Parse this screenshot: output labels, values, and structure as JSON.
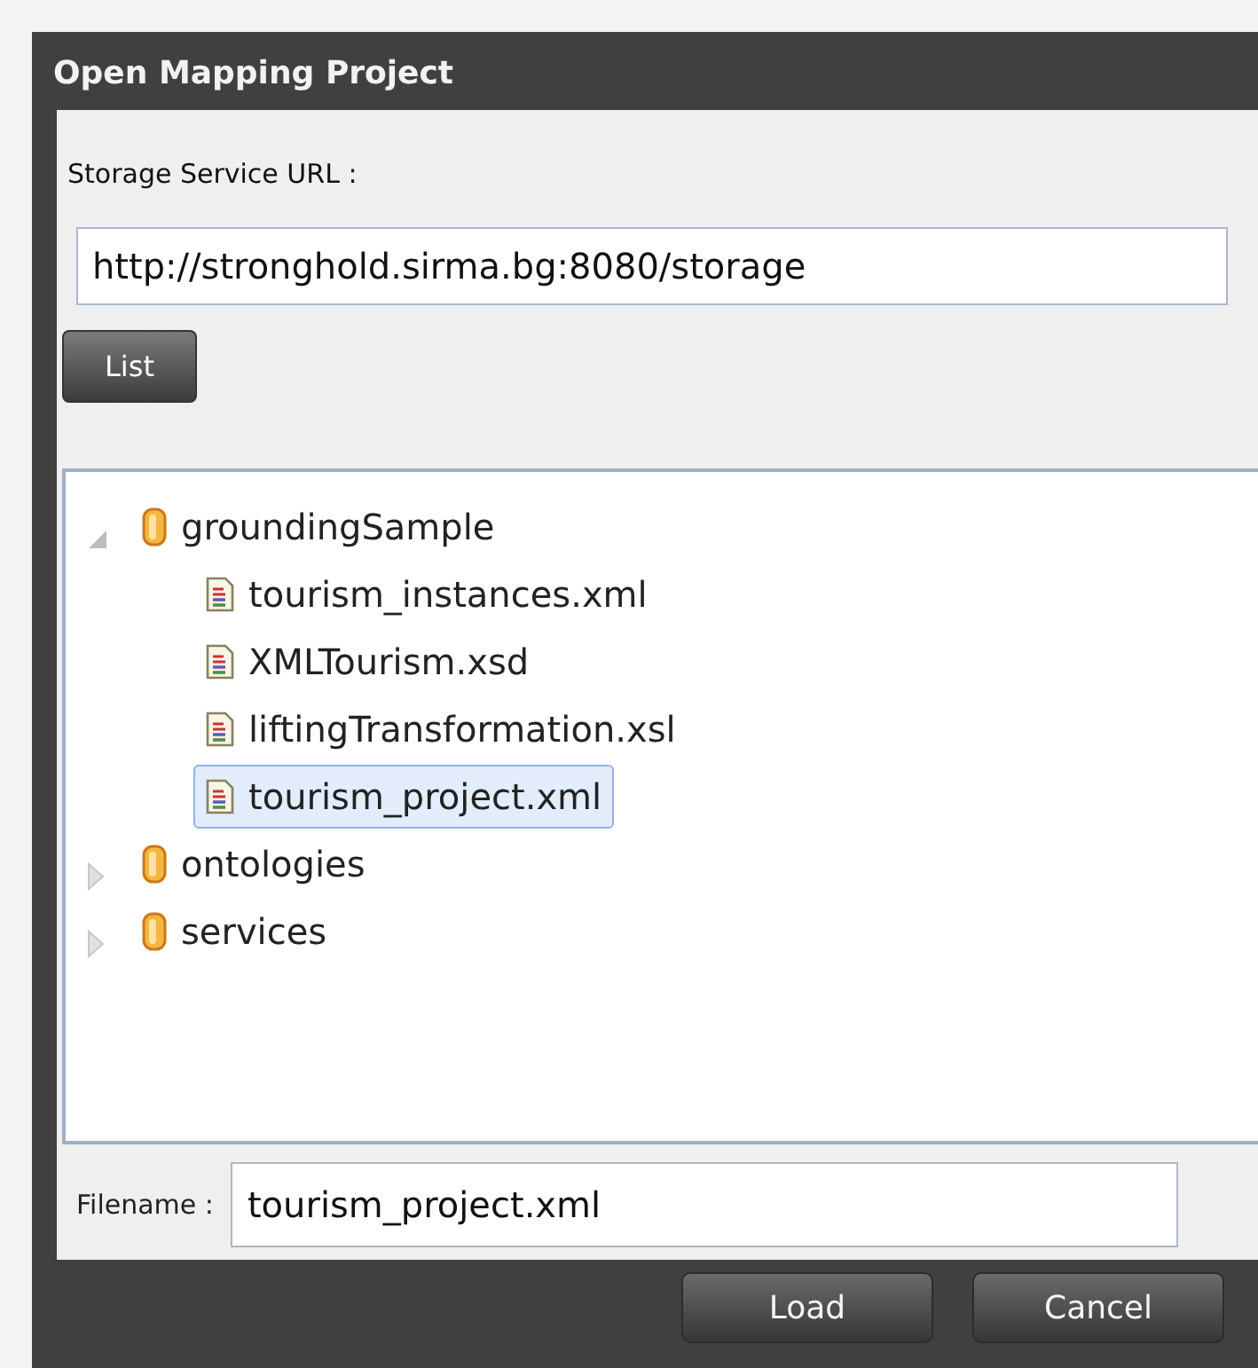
{
  "window": {
    "title": "Open Mapping Project"
  },
  "storage_url": {
    "label": "Storage Service URL :",
    "value": "http://stronghold.sirma.bg:8080/storage"
  },
  "list_button": "List",
  "tree": [
    {
      "label": "groundingSample",
      "kind": "folder",
      "expanded": true,
      "selected": false,
      "children": [
        {
          "label": "tourism_instances.xml",
          "kind": "file",
          "selected": false
        },
        {
          "label": "XMLTourism.xsd",
          "kind": "file",
          "selected": false
        },
        {
          "label": "liftingTransformation.xsl",
          "kind": "file",
          "selected": false
        },
        {
          "label": "tourism_project.xml",
          "kind": "file",
          "selected": true
        }
      ]
    },
    {
      "label": "ontologies",
      "kind": "folder",
      "expanded": false,
      "selected": false
    },
    {
      "label": "services",
      "kind": "folder",
      "expanded": false,
      "selected": false
    }
  ],
  "filename": {
    "label": "Filename :",
    "value": "tourism_project.xml"
  },
  "buttons": [
    "Load",
    "Cancel"
  ]
}
